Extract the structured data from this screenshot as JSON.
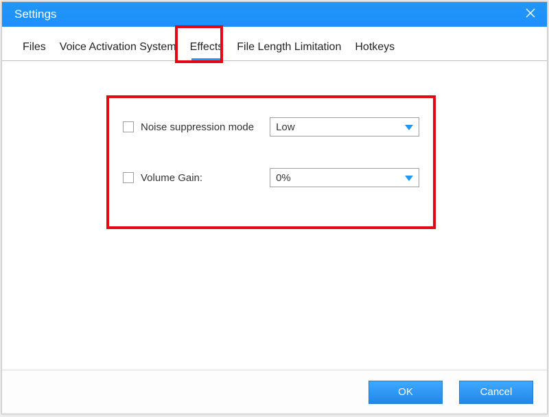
{
  "window": {
    "title": "Settings"
  },
  "tabs": {
    "files": "Files",
    "vas": "Voice Activation System",
    "effects": "Effects",
    "fll": "File Length Limitation",
    "hotkeys": "Hotkeys",
    "active": "effects"
  },
  "effects": {
    "noise_label": "Noise suppression mode",
    "noise_value": "Low",
    "gain_label": "Volume Gain:",
    "gain_value": "0%"
  },
  "footer": {
    "ok": "OK",
    "cancel": "Cancel"
  },
  "colors": {
    "accent": "#1e90ff",
    "highlight": "#e30613"
  }
}
